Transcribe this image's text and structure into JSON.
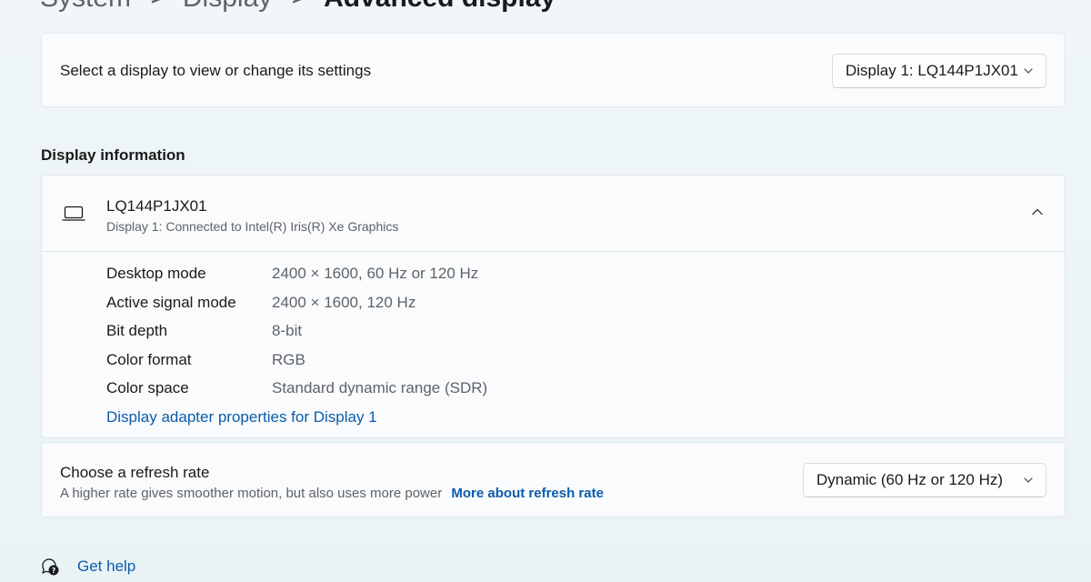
{
  "breadcrumb": {
    "items": [
      "System",
      "Display"
    ],
    "current": "Advanced display",
    "separator": ">"
  },
  "select_display": {
    "label": "Select a display to view or change its settings",
    "dropdown_value": "Display 1: LQ144P1JX01"
  },
  "display_information": {
    "section_title": "Display information",
    "header_title": "LQ144P1JX01",
    "header_subtitle": "Display 1: Connected to Intel(R) Iris(R) Xe Graphics",
    "properties": [
      {
        "key": "Desktop mode",
        "value": "2400 × 1600, 60 Hz or 120 Hz"
      },
      {
        "key": "Active signal mode",
        "value": "2400 × 1600, 120 Hz"
      },
      {
        "key": "Bit depth",
        "value": "8-bit"
      },
      {
        "key": "Color format",
        "value": "RGB"
      },
      {
        "key": "Color space",
        "value": "Standard dynamic range (SDR)"
      }
    ],
    "adapter_link": "Display adapter properties for Display 1"
  },
  "refresh_rate": {
    "title": "Choose a refresh rate",
    "description": "A higher rate gives smoother motion, but also uses more power",
    "more_link": "More about refresh rate",
    "dropdown_value": "Dynamic (60 Hz or 120 Hz)"
  },
  "help": {
    "label": "Get help",
    "icon": "help-chat-icon"
  },
  "colors": {
    "accent_link": "#0b5cab",
    "background": "#eef5f8",
    "card": "#f9fbfc",
    "secondary_text": "#5f6368"
  }
}
